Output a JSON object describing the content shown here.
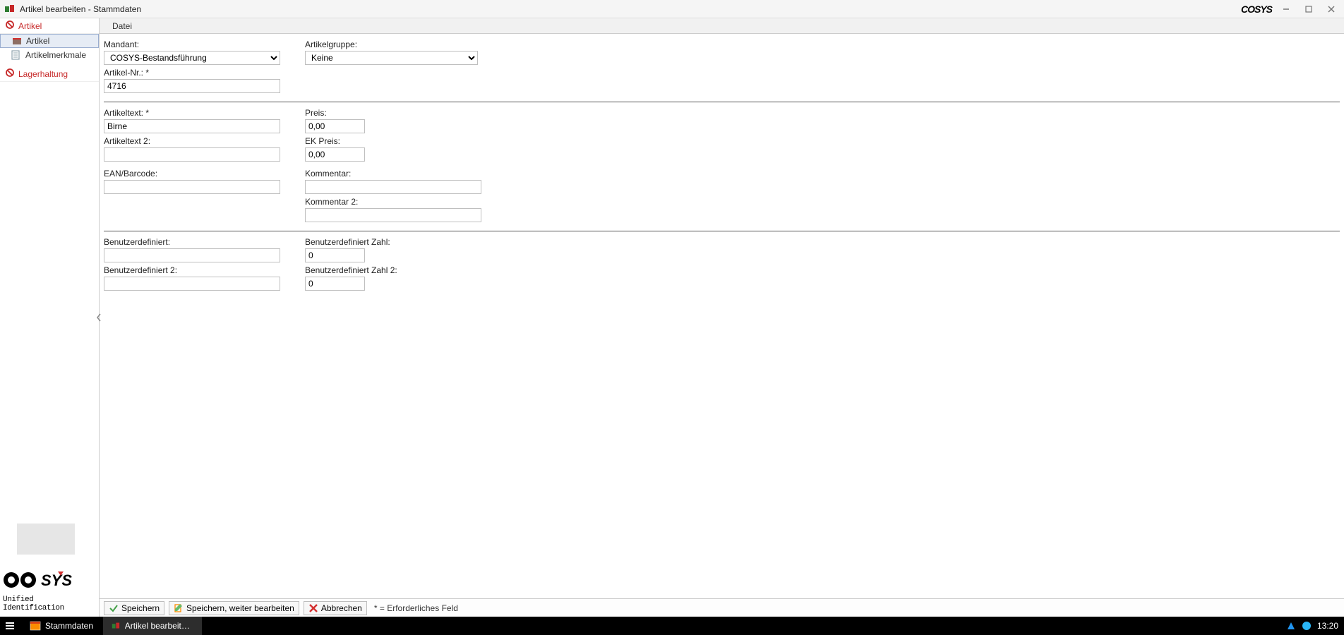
{
  "window": {
    "title": "Artikel bearbeiten - Stammdaten",
    "brand": "COSYS"
  },
  "sidebar": {
    "groups": {
      "artikel": {
        "label": "Artikel"
      },
      "lagerhaltung": {
        "label": "Lagerhaltung"
      }
    },
    "items": {
      "artikel": {
        "label": "Artikel"
      },
      "artikelmerkmale": {
        "label": "Artikelmerkmale"
      }
    },
    "logo_tag": "Unified Identification"
  },
  "menubar": {
    "datei": "Datei"
  },
  "form": {
    "mandant": {
      "label": "Mandant:",
      "value": "COSYS-Bestandsführung"
    },
    "artikelgruppe": {
      "label": "Artikelgruppe:",
      "value": "Keine"
    },
    "artikelnr": {
      "label": "Artikel-Nr.: *",
      "value": "4716"
    },
    "artikeltext": {
      "label": "Artikeltext: *",
      "value": "Birne"
    },
    "artikeltext2": {
      "label": "Artikeltext 2:",
      "value": ""
    },
    "preis": {
      "label": "Preis:",
      "value": "0,00"
    },
    "ekpreis": {
      "label": "EK Preis:",
      "value": "0,00"
    },
    "ean": {
      "label": "EAN/Barcode:",
      "value": ""
    },
    "kommentar": {
      "label": "Kommentar:",
      "value": ""
    },
    "kommentar2": {
      "label": "Kommentar 2:",
      "value": ""
    },
    "benutzer": {
      "label": "Benutzerdefiniert:",
      "value": ""
    },
    "benutzer2": {
      "label": "Benutzerdefiniert 2:",
      "value": ""
    },
    "benutzerzahl": {
      "label": "Benutzerdefiniert Zahl:",
      "value": "0"
    },
    "benutzerzahl2": {
      "label": "Benutzerdefiniert Zahl 2:",
      "value": "0"
    }
  },
  "footer": {
    "save": "Speichern",
    "save_continue": "Speichern, weiter bearbeiten",
    "cancel": "Abbrechen",
    "required_hint": "* = Erforderliches Feld"
  },
  "taskbar": {
    "items": {
      "stammdaten": "Stammdaten",
      "artikel": "Artikel bearbeiten - S..."
    },
    "clock": "13:20"
  }
}
